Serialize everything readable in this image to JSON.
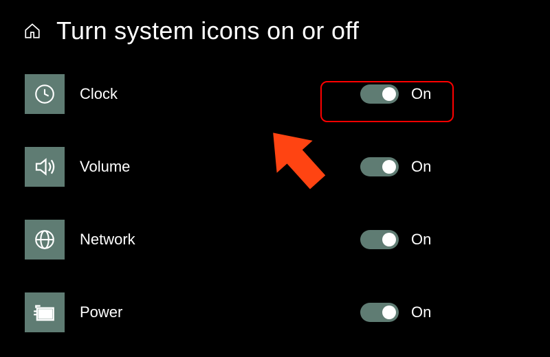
{
  "header": {
    "title": "Turn system icons on or off"
  },
  "items": [
    {
      "name": "clock",
      "label": "Clock",
      "icon": "clock-icon",
      "toggle_state": "on",
      "toggle_label": "On",
      "highlighted": true
    },
    {
      "name": "volume",
      "label": "Volume",
      "icon": "speaker-icon",
      "toggle_state": "on",
      "toggle_label": "On",
      "highlighted": false
    },
    {
      "name": "network",
      "label": "Network",
      "icon": "globe-icon",
      "toggle_state": "on",
      "toggle_label": "On",
      "highlighted": false
    },
    {
      "name": "power",
      "label": "Power",
      "icon": "power-icon",
      "toggle_state": "on",
      "toggle_label": "On",
      "highlighted": false
    }
  ],
  "annotations": {
    "arrow": "pointing to first toggle",
    "highlight": "red box around clock toggle"
  }
}
